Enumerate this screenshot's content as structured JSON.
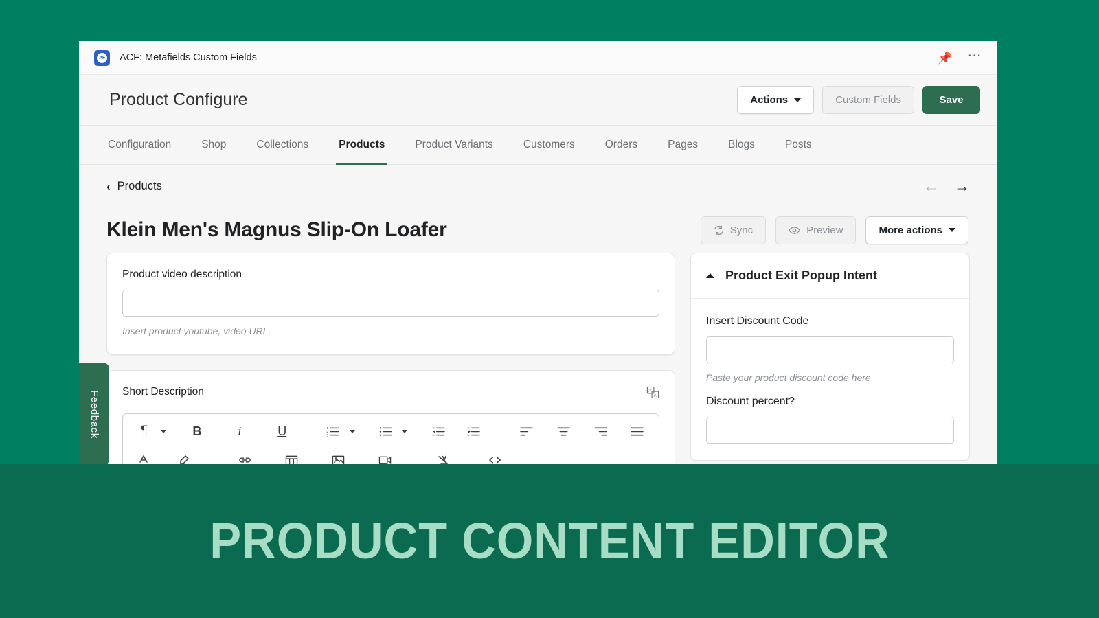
{
  "app_bar": {
    "icon_name": "acf-app-icon",
    "icon_text": "AF",
    "title": "ACF: Metafields Custom Fields",
    "pin_icon": "pin-icon",
    "more_icon": "more-horizontal-icon"
  },
  "header": {
    "title": "Product Configure",
    "actions_label": "Actions",
    "custom_fields_label": "Custom Fields",
    "save_label": "Save"
  },
  "tabs": [
    {
      "label": "Configuration",
      "active": false
    },
    {
      "label": "Shop",
      "active": false
    },
    {
      "label": "Collections",
      "active": false
    },
    {
      "label": "Products",
      "active": true
    },
    {
      "label": "Product Variants",
      "active": false
    },
    {
      "label": "Customers",
      "active": false
    },
    {
      "label": "Orders",
      "active": false
    },
    {
      "label": "Pages",
      "active": false
    },
    {
      "label": "Blogs",
      "active": false
    },
    {
      "label": "Posts",
      "active": false
    }
  ],
  "breadcrumb": {
    "back_chevron": "‹",
    "label": "Products"
  },
  "nav_arrows": {
    "prev": "←",
    "next": "→"
  },
  "product": {
    "title": "Klein Men's Magnus Slip-On Loafer",
    "sync_label": "Sync",
    "preview_label": "Preview",
    "more_actions_label": "More actions"
  },
  "video_card": {
    "label": "Product video description",
    "value": "",
    "placeholder": "",
    "help": "Insert product youtube, video URL."
  },
  "short_description": {
    "label": "Short Description",
    "translate_icon": "translate-icon",
    "toolbar_row1": [
      {
        "name": "paragraph-format-icon",
        "glyph": "¶",
        "caret": true
      },
      {
        "name": "bold-icon",
        "glyph": "B",
        "caret": false
      },
      {
        "name": "italic-icon",
        "glyph": "i",
        "caret": false
      },
      {
        "name": "underline-icon",
        "glyph": "U",
        "caret": false
      },
      {
        "name": "ordered-list-icon",
        "glyph": "",
        "caret": true
      },
      {
        "name": "bullet-list-icon",
        "glyph": "",
        "caret": true
      },
      {
        "name": "outdent-icon",
        "glyph": "",
        "caret": false
      },
      {
        "name": "indent-icon",
        "glyph": "",
        "caret": false
      },
      {
        "name": "align-left-icon",
        "glyph": "",
        "caret": false
      },
      {
        "name": "align-center-icon",
        "glyph": "",
        "caret": false
      },
      {
        "name": "align-right-icon",
        "glyph": "",
        "caret": false
      },
      {
        "name": "align-justify-icon",
        "glyph": "",
        "caret": false
      }
    ],
    "toolbar_row2": [
      {
        "name": "text-color-icon"
      },
      {
        "name": "highlight-color-icon"
      },
      {
        "name": "insert-link-icon"
      },
      {
        "name": "insert-table-icon"
      },
      {
        "name": "insert-image-icon"
      },
      {
        "name": "insert-video-icon"
      },
      {
        "name": "clear-formatting-icon"
      },
      {
        "name": "source-code-icon"
      }
    ]
  },
  "exit_popup_panel": {
    "title": "Product Exit Popup Intent",
    "collapse_icon": "triangle-up-icon",
    "discount_code": {
      "label": "Insert Discount Code",
      "value": "",
      "help": "Paste your product discount code here"
    },
    "discount_percent": {
      "label": "Discount percent?",
      "value": ""
    }
  },
  "feedback": {
    "label": "Feedback"
  },
  "banner": {
    "text": "PRODUCT CONTENT EDITOR"
  },
  "colors": {
    "page_background": "#008060",
    "banner_background": "#0a6b50",
    "banner_text": "#a6ddc4",
    "primary_green": "#2c6e4f",
    "app_icon_blue": "#2d5fc4",
    "pin_orange": "#d9870b"
  }
}
